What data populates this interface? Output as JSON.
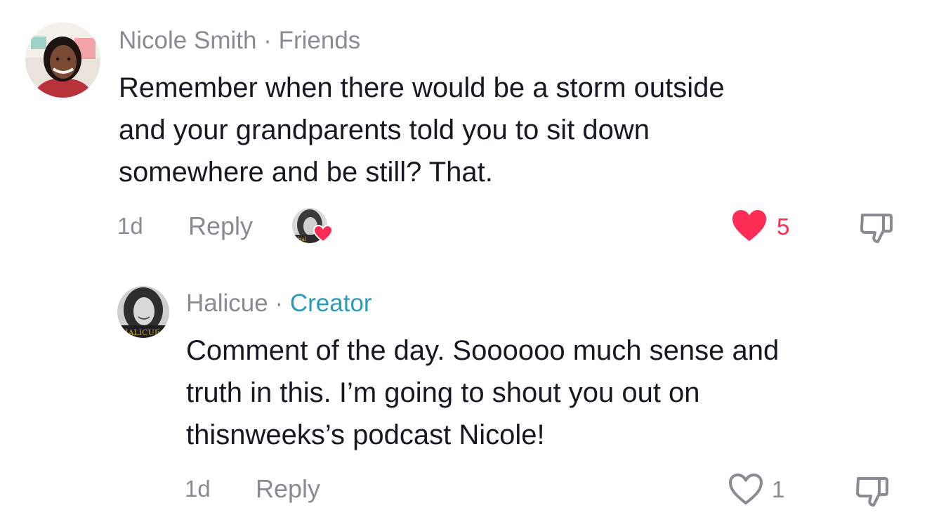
{
  "comment": {
    "author": "Nicole Smith",
    "separator": "·",
    "badge": "Friends",
    "text_lines": [
      "Remember when there would be a storm outside",
      "and your grandparents told you to sit down",
      "somewhere and be still? That."
    ],
    "time": "1d",
    "reply_label": "Reply",
    "like_count": "5",
    "liked": true,
    "creator_liked": true
  },
  "reply": {
    "author": "Halicue",
    "separator": "·",
    "badge": "Creator",
    "text_lines": [
      "Comment of the day. Soooooo much sense and",
      "truth in this. I’m going to shout you out on",
      "thisnweeks’s podcast Nicole!"
    ],
    "time": "1d",
    "reply_label": "Reply",
    "like_count": "1",
    "liked": false
  },
  "icons": {
    "like_filled": "heart-filled-icon",
    "like_outline": "heart-outline-icon",
    "dislike": "thumbs-down-icon"
  },
  "colors": {
    "like_red": "#fe2c55",
    "creator_blue": "#2a9bbb",
    "muted_gray": "#8a8b91",
    "text": "#161823"
  }
}
